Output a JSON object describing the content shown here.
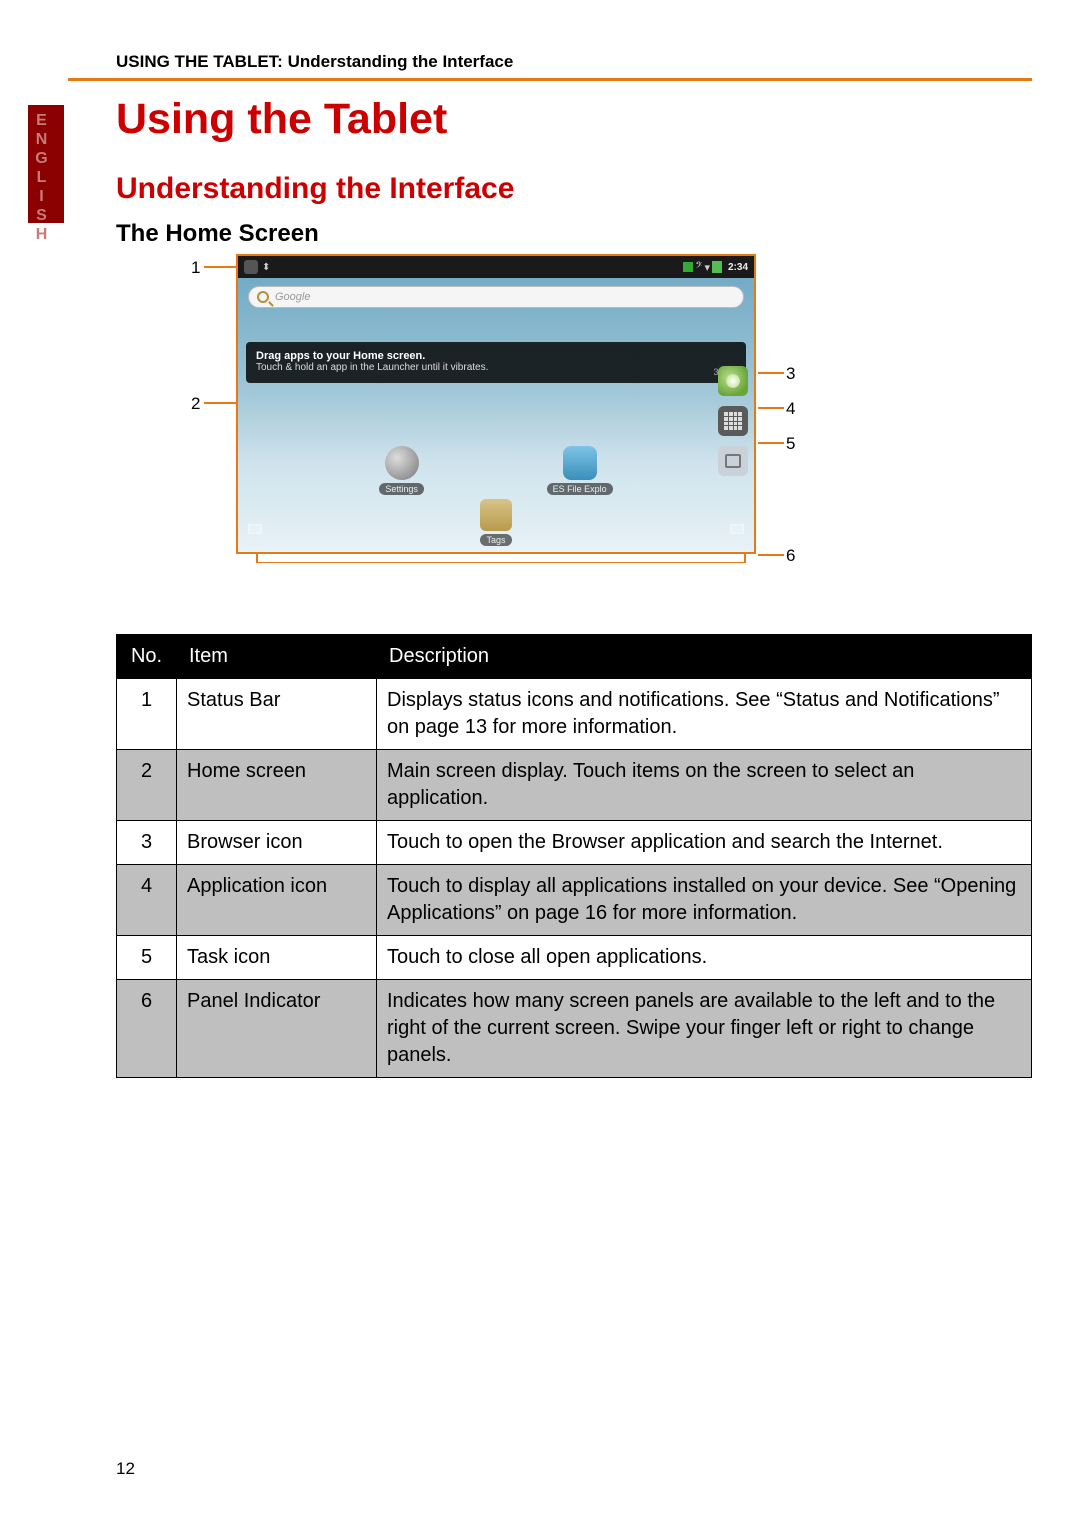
{
  "language_tab": "ENGLISH",
  "header_crumb": "USING THE TABLET: Understanding the Interface",
  "chapter_title": "Using the Tablet",
  "section_title": "Understanding the Interface",
  "subsection_title": "The Home Screen",
  "page_number": "12",
  "screenshot": {
    "status_time": "2:34",
    "search_placeholder": "Google",
    "hint_title": "Drag apps to your Home screen.",
    "hint_body": "Touch & hold an app in the Launcher until it vibrates.",
    "hint_dots": "3 of 6",
    "desk_icons": [
      {
        "label": "Settings"
      },
      {
        "label": "ES File Explo"
      }
    ],
    "bottom_dock_label": "Tags"
  },
  "callouts": [
    "1",
    "2",
    "3",
    "4",
    "5",
    "6"
  ],
  "table": {
    "headers": [
      "No.",
      "Item",
      "Description"
    ],
    "rows": [
      {
        "no": "1",
        "item": "Status Bar",
        "desc": "Displays status icons and notifications. See “Status and Notifications” on page 13 for more information."
      },
      {
        "no": "2",
        "item": "Home screen",
        "desc": "Main screen display. Touch items on the screen to select an application."
      },
      {
        "no": "3",
        "item": "Browser icon",
        "desc": "Touch to open the Browser application and search the Internet."
      },
      {
        "no": "4",
        "item": "Application icon",
        "desc": "Touch to display all applications installed on your device. See “Opening Applications” on page 16 for more information."
      },
      {
        "no": "5",
        "item": "Task icon",
        "desc": "Touch to close all open applications."
      },
      {
        "no": "6",
        "item": "Panel Indicator",
        "desc": "Indicates how many screen panels are available to the left and to the right of the current screen. Swipe your finger left or right to change panels."
      }
    ]
  }
}
